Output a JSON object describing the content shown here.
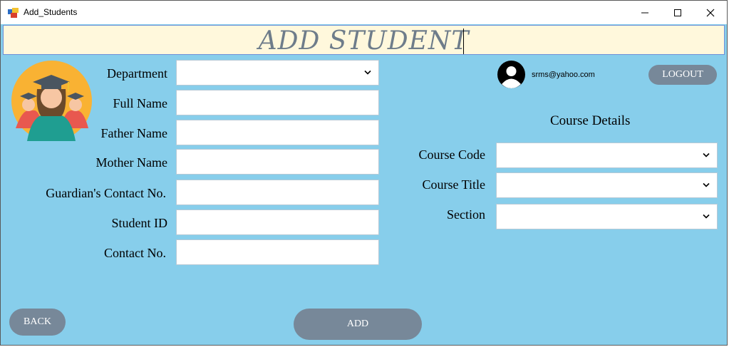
{
  "window": {
    "title": "Add_Students"
  },
  "header": {
    "title": "ADD STUDENT"
  },
  "form": {
    "department_label": "Department",
    "full_name_label": "Full Name",
    "father_name_label": "Father Name",
    "mother_name_label": "Mother Name",
    "guardian_contact_label": "Guardian's Contact No.",
    "student_id_label": "Student ID",
    "contact_label": "Contact No."
  },
  "user": {
    "email": "srms@yahoo.com",
    "logout_label": "LOGOUT"
  },
  "course": {
    "section_title": "Course Details",
    "code_label": "Course Code",
    "title_label": "Course Title",
    "section_label": "Section"
  },
  "buttons": {
    "back": "BACK",
    "add": "ADD"
  },
  "colors": {
    "background": "#87CEEB",
    "header_band": "#FFF8DC",
    "button": "#778899",
    "title_text": "#6E7C8A"
  }
}
